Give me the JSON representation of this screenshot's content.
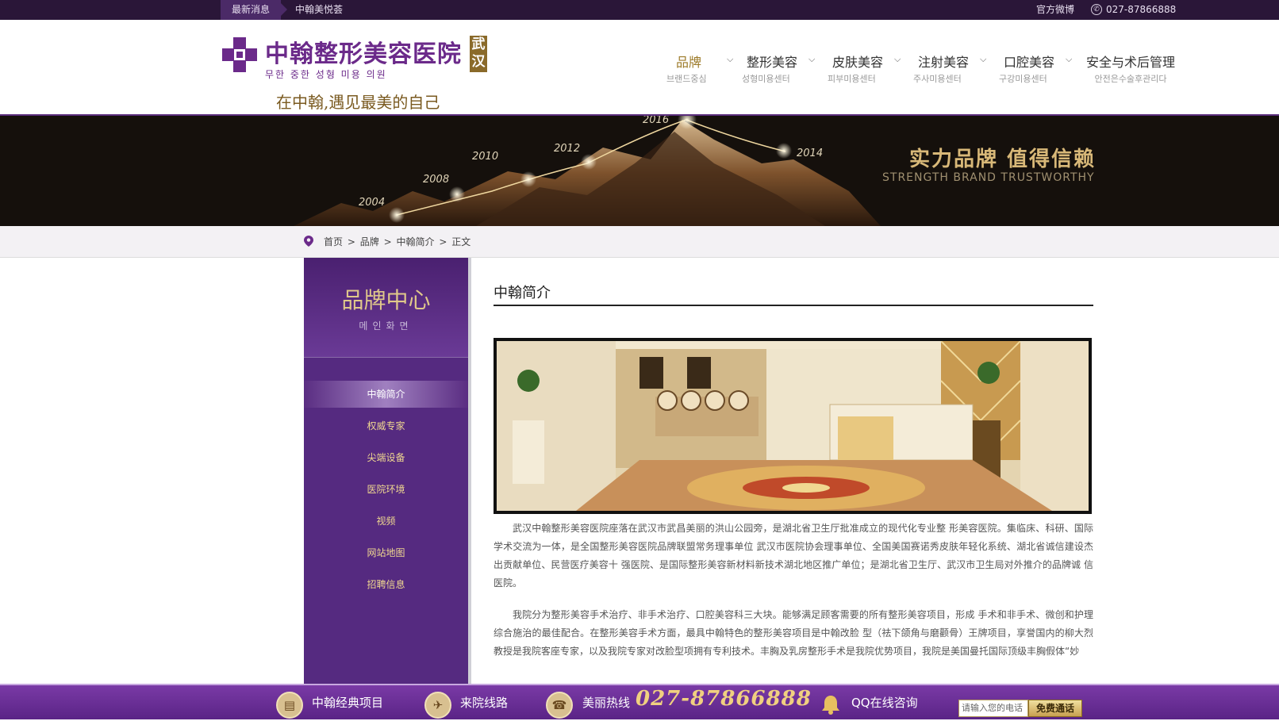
{
  "topbar": {
    "news_tag": "最新消息",
    "news_text": "中翰美悦荟",
    "weibo": "官方微博",
    "phone": "027-87866888"
  },
  "logo": {
    "name": "中翰整形美容医院",
    "city": "武汉",
    "korean": "무한 중한 성형 미용 의원",
    "slogan": "在中翰,遇见最美的自己"
  },
  "nav": [
    {
      "zh": "品牌",
      "ko": "브랜드중심",
      "active": true,
      "has_dropdown": true
    },
    {
      "zh": "整形美容",
      "ko": "성형미용센터",
      "active": false,
      "has_dropdown": true
    },
    {
      "zh": "皮肤美容",
      "ko": "피부미용센터",
      "active": false,
      "has_dropdown": true
    },
    {
      "zh": "注射美容",
      "ko": "주사미용센터",
      "active": false,
      "has_dropdown": true
    },
    {
      "zh": "口腔美容",
      "ko": "구강미용센터",
      "active": false,
      "has_dropdown": true
    },
    {
      "zh": "安全与术后管理",
      "ko": "안전은수술후관리다",
      "active": false,
      "has_dropdown": false
    }
  ],
  "banner": {
    "title": "实力品牌  值得信赖",
    "subtitle": "STRENGTH BRAND TRUSTWORTHY",
    "years": [
      "2004",
      "2008",
      "2010",
      "2012",
      "2016",
      "2014"
    ]
  },
  "breadcrumb": {
    "items": [
      "首页",
      "品牌",
      "中翰简介",
      "正文"
    ],
    "separator": ">"
  },
  "sidebar": {
    "title": "品牌中心",
    "subtitle": "메인화면",
    "items": [
      {
        "label": "中翰简介",
        "active": true
      },
      {
        "label": "权威专家",
        "active": false
      },
      {
        "label": "尖端设备",
        "active": false
      },
      {
        "label": "医院环境",
        "active": false
      },
      {
        "label": "视频",
        "active": false
      },
      {
        "label": "网站地图",
        "active": false
      },
      {
        "label": "招聘信息",
        "active": false
      }
    ]
  },
  "content": {
    "title": "中翰简介",
    "paragraphs": [
      "武汉中翰整形美容医院座落在武汉市武昌美丽的洪山公园旁，是湖北省卫生厅批准成立的现代化专业整 形美容医院。集临床、科研、国际学术交流为一体，是全国整形美容医院品牌联盟常务理事单位 武汉市医院协会理事单位、全国美国赛诺秀皮肤年轻化系统、湖北省诚信建设杰出贡献单位、民营医疗美容十 强医院、是国际整形美容新材料新技术湖北地区推广单位；是湖北省卫生厅、武汉市卫生局对外推介的品牌诚 信医院。",
      "我院分为整形美容手术治疗、非手术治疗、口腔美容科三大块。能够满足顾客需要的所有整形美容项目，形成 手术和非手术、微创和护理综合施治的最佳配合。在整形美容手术方面，最具中翰特色的整形美容项目是中翰改脸 型（祛下颌角与磨颧骨）王牌项目，享誉国内的柳大烈教授是我院客座专家，以及我院专家对改脸型项拥有专利技术。丰胸及乳房整形手术是我院优势项目，我院是美国曼托国际顶级丰胸假体“妙"
    ]
  },
  "bottombar": {
    "classic": "中翰经典项目",
    "route": "来院线路",
    "hotline_label": "美丽热线",
    "hotline": "027-87866888",
    "qq": "QQ在线咨询",
    "input_placeholder": "请输入您的电话",
    "call_button": "免费通话"
  },
  "colors": {
    "brand_purple": "#552a80",
    "gold": "#9c7a28",
    "topbar": "#2a1638"
  },
  "icons": [
    "phone-icon",
    "chevron-down-icon",
    "location-pin-icon",
    "box-icon",
    "plane-icon",
    "telephone-icon",
    "bell-icon"
  ]
}
